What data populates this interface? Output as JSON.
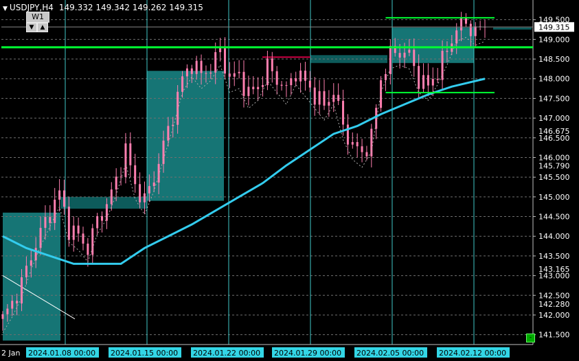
{
  "header": {
    "symbol": "USDJPY,H4",
    "prices": "149.332 149.342 149.262 149.315",
    "triangle_icon": "▼"
  },
  "timeframe": {
    "label": "W1",
    "down_arrow": "▼",
    "up_arrow": "▲"
  },
  "colors": {
    "background": "#000000",
    "bull": "#ff7fb0",
    "bear": "#ff7fb0",
    "ma_slow": "#33ccee",
    "zone": "#0f6b6b",
    "zone2": "#1a8a8a",
    "green_line": "#00ff33",
    "axis": "#c0c0c0",
    "grid": "#707070",
    "vline": "#40c8c8",
    "time_badge": "#33d6e6"
  },
  "chart_data": {
    "type": "candlestick",
    "symbol": "USDJPY",
    "timeframe": "H4",
    "ylim": [
      141.25,
      150.0
    ],
    "y_ticks": [
      141.5,
      142.0,
      142.5,
      143.0,
      143.5,
      144.0,
      144.5,
      145.0,
      145.5,
      146.0,
      146.5,
      147.0,
      147.5,
      148.0,
      148.5,
      149.0,
      149.5
    ],
    "y_tick_labels": [
      "141.500",
      "142.000",
      "142.500",
      "143.000",
      "143.500",
      "144.000",
      "144.500",
      "145.000",
      "145.500",
      "146.000",
      "146.500",
      "147.000",
      "147.500",
      "148.000",
      "148.500",
      "149.000",
      "149.500"
    ],
    "price_labels": [
      {
        "value": 149.315,
        "text": "149.315",
        "style": "current"
      },
      {
        "value": 146.675,
        "text": "146.675",
        "style": "plain"
      },
      {
        "value": 145.79,
        "text": "145.790",
        "style": "plain"
      },
      {
        "value": 143.165,
        "text": "143.165",
        "style": "plain"
      },
      {
        "value": 142.28,
        "text": "142.280",
        "style": "plain"
      }
    ],
    "x_labels": [
      {
        "text": "2 Jan",
        "style": "plain"
      },
      {
        "text": "2024.01.08 00:00",
        "style": "badge"
      },
      {
        "text": "2024.01.15 00:00",
        "style": "badge"
      },
      {
        "text": "2024.01.22 00:00",
        "style": "badge"
      },
      {
        "text": "2024.01.29 00:00",
        "style": "badge"
      },
      {
        "text": "2024.02.05 00:00",
        "style": "badge"
      },
      {
        "text": "2024.02.12 00:00",
        "style": "badge"
      }
    ],
    "close_path": [
      [
        0,
        141.9
      ],
      [
        2,
        142.3
      ],
      [
        4,
        142.8
      ],
      [
        6,
        143.5
      ],
      [
        8,
        144.1
      ],
      [
        10,
        144.6
      ],
      [
        12,
        145.1
      ],
      [
        14,
        144.2
      ],
      [
        16,
        144.0
      ],
      [
        18,
        143.7
      ],
      [
        20,
        144.4
      ],
      [
        22,
        144.8
      ],
      [
        24,
        145.4
      ],
      [
        26,
        146.2
      ],
      [
        28,
        145.3
      ],
      [
        30,
        144.9
      ],
      [
        32,
        145.5
      ],
      [
        34,
        146.3
      ],
      [
        36,
        147.1
      ],
      [
        38,
        148.0
      ],
      [
        40,
        148.4
      ],
      [
        42,
        148.1
      ],
      [
        44,
        148.3
      ],
      [
        46,
        148.7
      ],
      [
        48,
        148.0
      ],
      [
        50,
        148.1
      ],
      [
        52,
        147.6
      ],
      [
        54,
        147.8
      ],
      [
        56,
        148.3
      ],
      [
        58,
        148.0
      ],
      [
        60,
        147.7
      ],
      [
        62,
        148.2
      ],
      [
        64,
        147.9
      ],
      [
        66,
        147.6
      ],
      [
        68,
        147.3
      ],
      [
        70,
        147.7
      ],
      [
        72,
        146.8
      ],
      [
        74,
        146.3
      ],
      [
        76,
        146.1
      ],
      [
        78,
        146.5
      ],
      [
        80,
        148.0
      ],
      [
        82,
        148.6
      ],
      [
        84,
        148.7
      ],
      [
        86,
        148.6
      ],
      [
        88,
        148.0
      ],
      [
        90,
        147.8
      ],
      [
        92,
        148.2
      ],
      [
        94,
        148.7
      ],
      [
        96,
        149.3
      ],
      [
        98,
        149.4
      ],
      [
        100,
        149.2
      ],
      [
        102,
        149.3
      ]
    ],
    "ma_slow": [
      [
        0,
        144.0
      ],
      [
        5,
        143.7
      ],
      [
        10,
        143.5
      ],
      [
        15,
        143.3
      ],
      [
        20,
        143.3
      ],
      [
        25,
        143.3
      ],
      [
        30,
        143.7
      ],
      [
        35,
        144.0
      ],
      [
        40,
        144.3
      ],
      [
        45,
        144.65
      ],
      [
        50,
        145.0
      ],
      [
        55,
        145.35
      ],
      [
        60,
        145.8
      ],
      [
        65,
        146.2
      ],
      [
        70,
        146.6
      ],
      [
        75,
        146.8
      ],
      [
        80,
        147.1
      ],
      [
        85,
        147.35
      ],
      [
        90,
        147.6
      ],
      [
        95,
        147.8
      ],
      [
        102,
        148.0
      ]
    ],
    "levels": [
      {
        "name": "level-148-8",
        "value": 148.8,
        "x0": 0,
        "x1": 102,
        "width": 3
      },
      {
        "name": "level-149-55",
        "value": 149.55,
        "x0": 81,
        "x1": 102,
        "width": 2
      },
      {
        "name": "level-147-65",
        "value": 147.65,
        "x0": 81,
        "x1": 102,
        "width": 2
      }
    ],
    "zones": [
      {
        "name": "zone-1",
        "x0": 0,
        "x1": 12,
        "y0": 144.6,
        "y1": 141.35
      },
      {
        "name": "zone-2",
        "x0": 12,
        "x1": 30,
        "y0": 145.0,
        "y1": 144.7
      },
      {
        "name": "zone-3",
        "x0": 30,
        "x1": 46,
        "y0": 148.2,
        "y1": 144.9
      },
      {
        "name": "zone-4",
        "x0": 64,
        "x1": 80,
        "y0": 148.6,
        "y1": 148.4
      },
      {
        "name": "zone-5",
        "x0": 81,
        "x1": 98,
        "y0": 149.3,
        "y1": 148.4
      },
      {
        "name": "zone-6",
        "x0": 102,
        "x1": 110,
        "y0": 149.3,
        "y1": 149.25
      }
    ]
  }
}
